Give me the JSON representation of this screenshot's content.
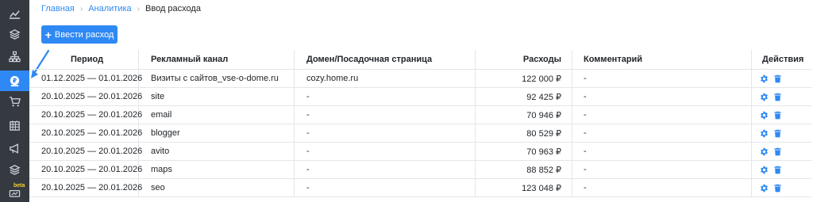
{
  "sidebar": {
    "items": [
      {
        "icon": "chart-icon"
      },
      {
        "icon": "layers-icon"
      },
      {
        "icon": "sitemap-icon"
      },
      {
        "icon": "expense-icon",
        "active": true
      },
      {
        "icon": "cart-icon"
      },
      {
        "icon": "calendar-icon"
      },
      {
        "icon": "megaphone-icon"
      },
      {
        "icon": "stack-icon"
      },
      {
        "icon": "beta-feature-icon",
        "badge": "beta"
      }
    ]
  },
  "breadcrumb": {
    "home": "Главная",
    "analytics": "Аналитика",
    "current": "Ввод расхода"
  },
  "toolbar": {
    "add_label": "Ввести расход"
  },
  "table": {
    "headers": {
      "period": "Период",
      "channel": "Рекламный канал",
      "domain": "Домен/Посадочная страница",
      "cost": "Расходы",
      "comment": "Комментарий",
      "actions": "Действия"
    },
    "rows": [
      {
        "period": "01.12.2025 — 01.01.2026",
        "channel": "Визиты с сайтов_vse-o-dome.ru",
        "domain": "cozy.home.ru",
        "cost": "122 000 ₽",
        "comment": "-"
      },
      {
        "period": "20.10.2025 — 20.01.2026",
        "channel": "site",
        "domain": "-",
        "cost": "92 425 ₽",
        "comment": "-"
      },
      {
        "period": "20.10.2025 — 20.01.2026",
        "channel": "email",
        "domain": "-",
        "cost": "70 946 ₽",
        "comment": "-"
      },
      {
        "period": "20.10.2025 — 20.01.2026",
        "channel": "blogger",
        "domain": "-",
        "cost": "80 529 ₽",
        "comment": "-"
      },
      {
        "period": "20.10.2025 — 20.01.2026",
        "channel": "avito",
        "domain": "-",
        "cost": "70 963 ₽",
        "comment": "-"
      },
      {
        "period": "20.10.2025 — 20.01.2026",
        "channel": "maps",
        "domain": "-",
        "cost": "88 852 ₽",
        "comment": "-"
      },
      {
        "period": "20.10.2025 — 20.01.2026",
        "channel": "seo",
        "domain": "-",
        "cost": "123 048 ₽",
        "comment": "-"
      }
    ]
  },
  "colors": {
    "accent": "#2f89f5",
    "sidebar": "#343a40",
    "beta": "#f5d033"
  }
}
